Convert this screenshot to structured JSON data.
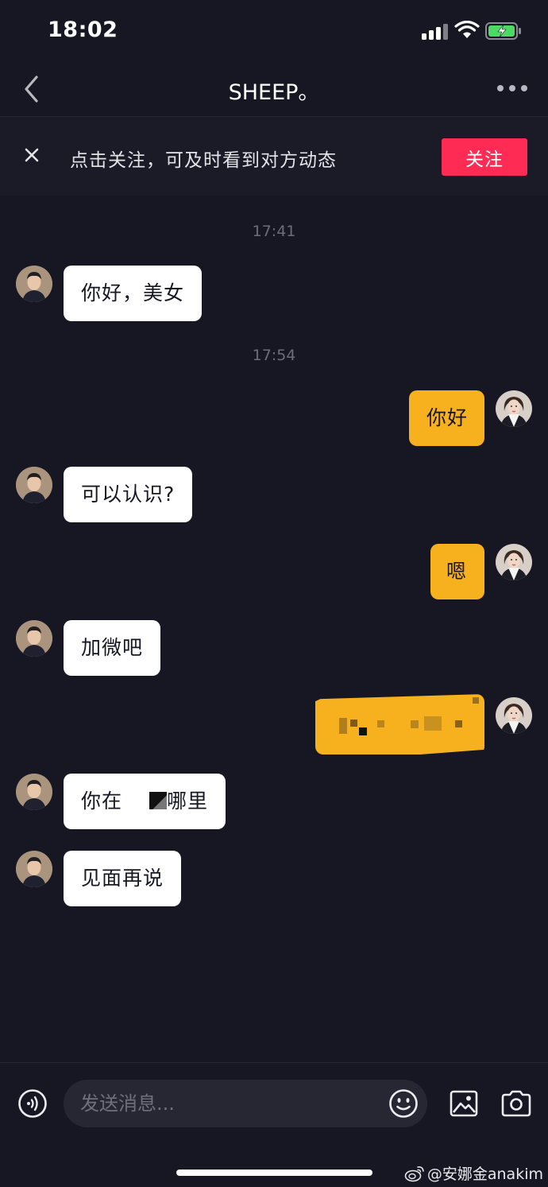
{
  "status_bar": {
    "time": "18:02"
  },
  "header": {
    "title": "SHEEP。"
  },
  "follow_banner": {
    "text": "点击关注，可及时看到对方动态",
    "follow_label": "关注"
  },
  "messages": {
    "ts1": "17:41",
    "ts2": "17:54",
    "m1": "你好，美女",
    "m2": "你好",
    "m3": "可以认识?",
    "m4": "嗯",
    "m5": "加微吧",
    "m6_part1": "你在",
    "m6_part2": "哪里",
    "m7": "见面再说"
  },
  "input": {
    "placeholder": "发送消息..."
  },
  "watermark": {
    "text": "@安娜金anakim"
  },
  "colors": {
    "background": "#161722",
    "incoming_bubble": "#ffffff",
    "outgoing_bubble": "#f7b11f",
    "follow_button": "#fe2c55"
  },
  "icons": [
    "back-icon",
    "more-icon",
    "close-icon",
    "voice-icon",
    "emoji-icon",
    "image-icon",
    "camera-icon",
    "weibo-icon"
  ]
}
